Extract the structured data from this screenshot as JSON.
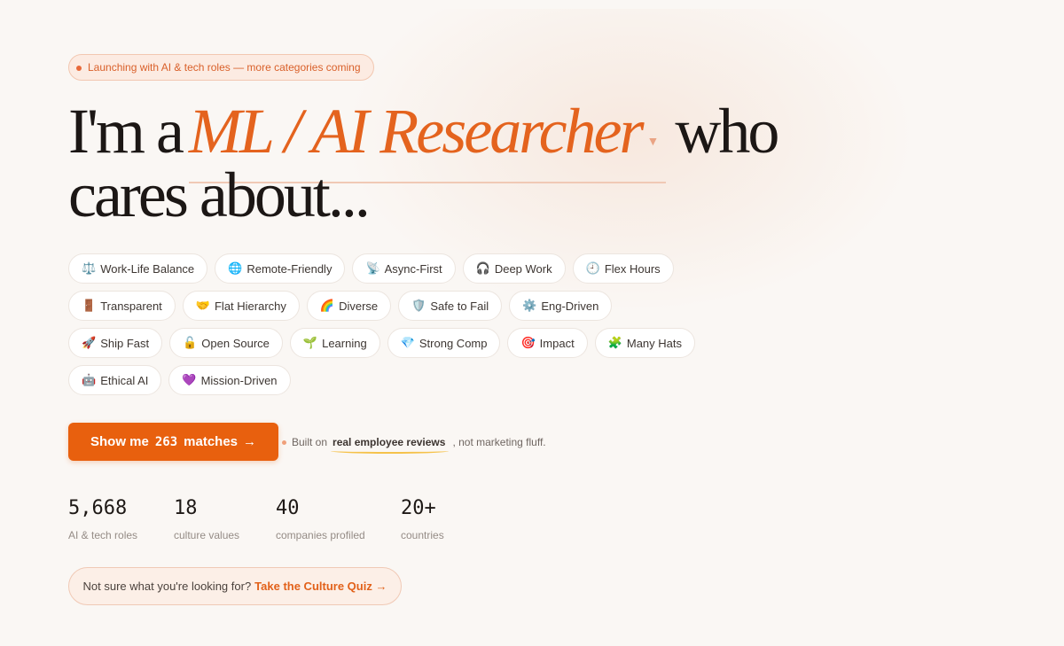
{
  "badge": {
    "text": "Launching with AI & tech roles — more categories coming"
  },
  "headline": {
    "prefix": "I'm a",
    "role": "ML / AI Researcher",
    "suffix": "who",
    "line2": "cares about..."
  },
  "values": [
    {
      "icon": "⚖️",
      "icon_name": "balance-scale-icon",
      "label": "Work-Life Balance"
    },
    {
      "icon": "🌐",
      "icon_name": "globe-icon",
      "label": "Remote-Friendly"
    },
    {
      "icon": "📡",
      "icon_name": "satellite-dish-icon",
      "label": "Async-First"
    },
    {
      "icon": "🎧",
      "icon_name": "headphones-icon",
      "label": "Deep Work"
    },
    {
      "icon": "🕘",
      "icon_name": "clock-icon",
      "label": "Flex Hours"
    },
    {
      "icon": "🚪",
      "icon_name": "door-icon",
      "label": "Transparent"
    },
    {
      "icon": "🤝",
      "icon_name": "handshake-icon",
      "label": "Flat Hierarchy"
    },
    {
      "icon": "🌈",
      "icon_name": "rainbow-icon",
      "label": "Diverse"
    },
    {
      "icon": "🛡️",
      "icon_name": "shield-icon",
      "label": "Safe to Fail"
    },
    {
      "icon": "⚙️",
      "icon_name": "gear-icon",
      "label": "Eng-Driven"
    },
    {
      "icon": "🚀",
      "icon_name": "rocket-icon",
      "label": "Ship Fast"
    },
    {
      "icon": "🔓",
      "icon_name": "unlocked-icon",
      "label": "Open Source"
    },
    {
      "icon": "🌱",
      "icon_name": "seedling-icon",
      "label": "Learning"
    },
    {
      "icon": "💎",
      "icon_name": "gem-icon",
      "label": "Strong Comp"
    },
    {
      "icon": "🎯",
      "icon_name": "target-icon",
      "label": "Impact"
    },
    {
      "icon": "🧩",
      "icon_name": "puzzle-icon",
      "label": "Many Hats"
    },
    {
      "icon": "🤖",
      "icon_name": "robot-icon",
      "label": "Ethical AI"
    },
    {
      "icon": "💜",
      "icon_name": "purple-heart-icon",
      "label": "Mission-Driven"
    }
  ],
  "cta": {
    "prefix": "Show me",
    "count": "263",
    "suffix": "matches",
    "arrow": "→"
  },
  "note": {
    "before": "Built on",
    "emphasis": "real employee reviews",
    "after": ", not marketing fluff."
  },
  "stats": [
    {
      "value": "5,668",
      "label": "AI & tech roles"
    },
    {
      "value": "18",
      "label": "culture values"
    },
    {
      "value": "40",
      "label": "companies profiled"
    },
    {
      "value": "20+",
      "label": "countries"
    }
  ],
  "quiz": {
    "prompt": "Not sure what you're looking for?",
    "link": "Take the Culture Quiz →"
  },
  "colors": {
    "accent": "#e8600e",
    "background": "#faf7f4",
    "highlight": "#f5c24a"
  }
}
